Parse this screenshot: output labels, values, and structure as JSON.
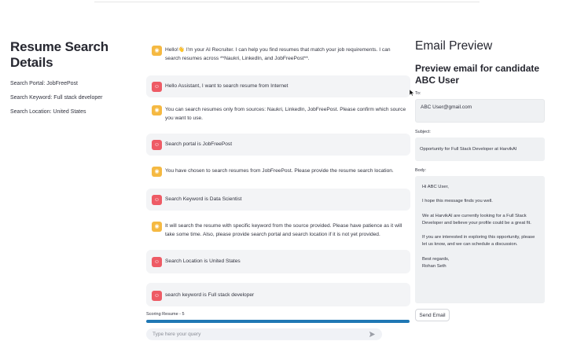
{
  "details": {
    "title": "Resume Search Details",
    "portal": "Search Portal: JobFreePost",
    "keyword": "Search Keyword: Full stack developer",
    "location": "Search Location: United States"
  },
  "chat": {
    "messages": [
      {
        "role": "assistant",
        "text": "Hello!👋 I'm your AI Recruiter. I can help you find resumes that match your job requirements. I can search resumes across **Naukri, LinkedIn, and JobFreePost**."
      },
      {
        "role": "user",
        "text": "Hello Assistant, I want to search resume from Internet"
      },
      {
        "role": "assistant",
        "text": "You can search resumes only from sources: Naukri, LinkedIn, JobFreePost. Please confirm which source you want to use."
      },
      {
        "role": "user",
        "text": "Search portal is JobFreePost"
      },
      {
        "role": "assistant",
        "text": "You have chosen to search resumes from JobFreePost. Please provide the resume search location."
      },
      {
        "role": "user",
        "text": "Search Keyword is Data Scientist"
      },
      {
        "role": "assistant",
        "text": "It will search the resume with specific keyword from the source provided. Please have patience as it will take some time. Also, please provide search portal and search location if it is not yet provided."
      },
      {
        "role": "user",
        "text": "Search Location is United States"
      },
      {
        "role": "user",
        "text": "search keyword is Full stack developer"
      }
    ],
    "progress_label": "Scoring Resume - 5",
    "progress": 1.0,
    "input_placeholder": "Type here your query"
  },
  "email": {
    "title": "Email Preview",
    "subtitle": "Preview email for candidate ABC User",
    "to_label": "To:",
    "to_value": "ABC User@gmail.com",
    "subject_label": "Subject:",
    "subject_value": "Opportunity for Full Stack Developer at HarvikAI",
    "body_label": "Body:",
    "body_greeting": "Hi ABC User,",
    "body_p1": "I hope this message finds you well.",
    "body_p2": "We at HarvikAI are currently looking for a Full Stack Developer and believe your profile could be a great fit.",
    "body_p3": "If you are interested in exploring this opportunity, please let us know, and we can schedule a discussion.",
    "body_closing": "Best regards,",
    "body_signature": "Rohan Seth",
    "send_label": "Send Email"
  },
  "colors": {
    "assistant_avatar": "#f5b942",
    "user_avatar": "#ee5b65",
    "progress": "#1f77b4"
  },
  "icons": {
    "assistant_avatar": "robot-icon",
    "user_avatar": "smiley-icon",
    "send": "send-icon"
  }
}
